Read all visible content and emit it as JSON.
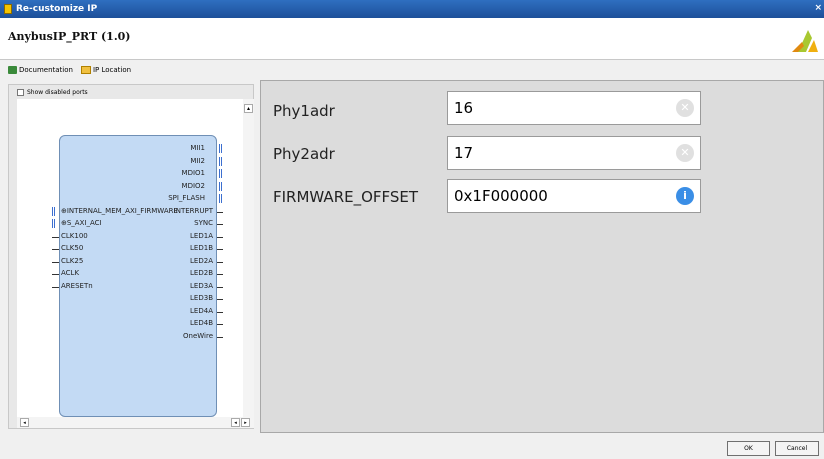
{
  "window": {
    "title": "Re-customize IP",
    "close_glyph": "×"
  },
  "header": {
    "ip_name": "AnybusIP_PRT (1.0)",
    "logo_icon": "xilinx-logo-icon"
  },
  "toolbar": {
    "documentation": "Documentation",
    "ip_location": "IP Location"
  },
  "left_panel": {
    "show_disabled_ports": "Show disabled ports",
    "right_ports": [
      "MII1",
      "MII2",
      "MDIO1",
      "MDIO2",
      "SPI_FLASH",
      "INTERRUPT",
      "SYNC",
      "LED1A",
      "LED1B",
      "LED2A",
      "LED2B",
      "LED3A",
      "LED3B",
      "LED4A",
      "LED4B",
      "OneWire"
    ],
    "left_ports": [
      "INTERNAL_MEM_AXI_FIRMWARE",
      "S_AXI_ACI",
      "CLK100",
      "CLK50",
      "CLK25",
      "ACLK",
      "ARESETn"
    ]
  },
  "params": [
    {
      "label": "Phy1adr",
      "value": "16",
      "icon": "clear-icon"
    },
    {
      "label": "Phy2adr",
      "value": "17",
      "icon": "clear-icon"
    },
    {
      "label": "FIRMWARE_OFFSET",
      "value": "0x1F000000",
      "icon": "info-icon"
    }
  ],
  "buttons": {
    "ok": "OK",
    "cancel": "Cancel"
  },
  "colors": {
    "titlebar": "#2f6fc0",
    "ip_block": "#c3daf4",
    "info": "#3a8ee6"
  }
}
